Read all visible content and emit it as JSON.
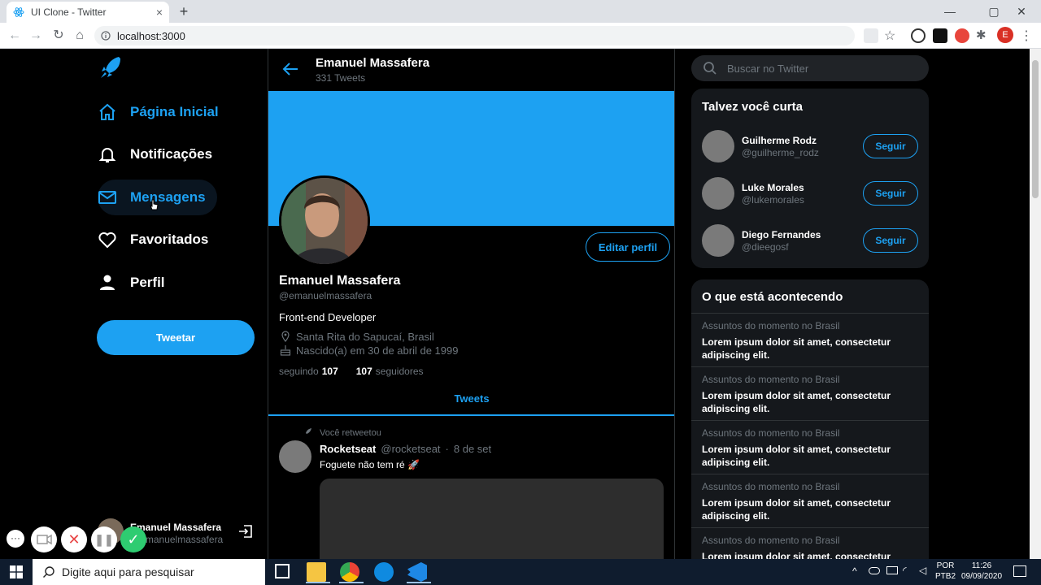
{
  "browser": {
    "tab_title": "UI Clone - Twitter",
    "tab_close": "×",
    "new_tab": "+",
    "url": "localhost:3000",
    "profile_initial": "E"
  },
  "sidebar": {
    "items": [
      {
        "label": "Página Inicial",
        "icon": "home-icon",
        "active": true
      },
      {
        "label": "Notificações",
        "icon": "bell-icon",
        "active": false
      },
      {
        "label": "Mensagens",
        "icon": "mail-icon",
        "active": true
      },
      {
        "label": "Favoritados",
        "icon": "heart-icon",
        "active": false
      },
      {
        "label": "Perfil",
        "icon": "person-icon",
        "active": false
      }
    ],
    "tweet_button": "Tweetar",
    "user_name": "Emanuel Massafera",
    "user_handle": "@emanuelmassafera"
  },
  "header": {
    "name": "Emanuel Massafera",
    "tweets_count": "331 Tweets"
  },
  "profile": {
    "edit_button": "Editar perfil",
    "name": "Emanuel Massafera",
    "handle": "@emanuelmassafera",
    "bio": "Front-end Developer",
    "location": "Santa Rita do Sapucaí, Brasil",
    "birthday": "Nascido(a) em 30 de abril de 1999",
    "following_label": "seguindo",
    "following_count": "107",
    "followers_count": "107",
    "followers_label": "seguidores",
    "tab_label": "Tweets"
  },
  "tweet": {
    "retweet_note": "Você retweetou",
    "author": "Rocketseat",
    "handle": "@rocketseat",
    "dot": "·",
    "date": "8 de set",
    "text": "Foguete não tem ré 🚀"
  },
  "right": {
    "search_placeholder": "Buscar no Twitter",
    "suggestions_title": "Talvez você curta",
    "follow_label": "Seguir",
    "suggestions": [
      {
        "name": "Guilherme Rodz",
        "handle": "@guilherme_rodz"
      },
      {
        "name": "Luke Morales",
        "handle": "@lukemorales"
      },
      {
        "name": "Diego Fernandes",
        "handle": "@dieegosf"
      }
    ],
    "trends_title": "O que está acontecendo",
    "trends": [
      {
        "context": "Assuntos do momento no Brasil",
        "text": "Lorem ipsum dolor sit amet, consectetur adipiscing elit."
      },
      {
        "context": "Assuntos do momento no Brasil",
        "text": "Lorem ipsum dolor sit amet, consectetur adipiscing elit."
      },
      {
        "context": "Assuntos do momento no Brasil",
        "text": "Lorem ipsum dolor sit amet, consectetur adipiscing elit."
      },
      {
        "context": "Assuntos do momento no Brasil",
        "text": "Lorem ipsum dolor sit amet, consectetur adipiscing elit."
      },
      {
        "context": "Assuntos do momento no Brasil",
        "text": "Lorem ipsum dolor sit amet, consectetur"
      }
    ]
  },
  "taskbar": {
    "search_placeholder": "Digite aqui para pesquisar",
    "lang_top": "POR",
    "lang_bottom": "PTB2",
    "time": "11:26",
    "date": "09/09/2020"
  },
  "colors": {
    "accent": "#1da1f2",
    "background": "#000000",
    "panel": "#15181c",
    "border": "#2f3336",
    "muted": "#6e767d"
  }
}
